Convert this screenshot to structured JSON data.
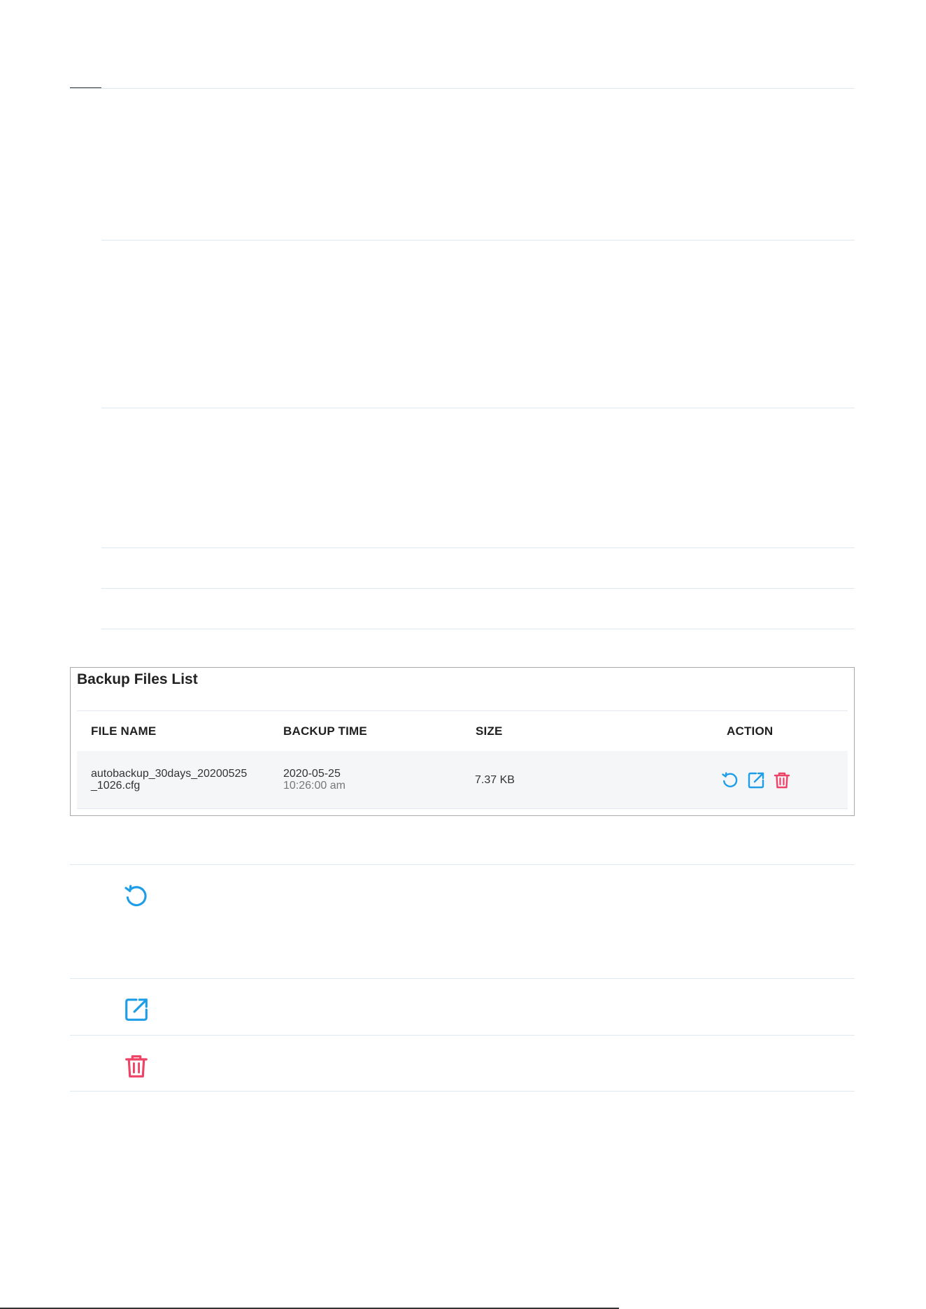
{
  "backup_panel": {
    "title": "Backup Files List",
    "columns": {
      "file_name": "FILE NAME",
      "backup_time": "BACKUP TIME",
      "size": "SIZE",
      "action": "ACTION"
    },
    "rows": [
      {
        "file_name_line1": "autobackup_30days_20200525",
        "file_name_line2": "_1026.cfg",
        "date": "2020-05-25",
        "time": "10:26:00 am",
        "size": "7.37 KB"
      }
    ]
  },
  "icons": {
    "restore": "restore-icon",
    "export": "export-icon",
    "delete": "delete-icon"
  },
  "colors": {
    "restore": "#1e9ee6",
    "export": "#1e9ee6",
    "delete": "#ee4266"
  }
}
